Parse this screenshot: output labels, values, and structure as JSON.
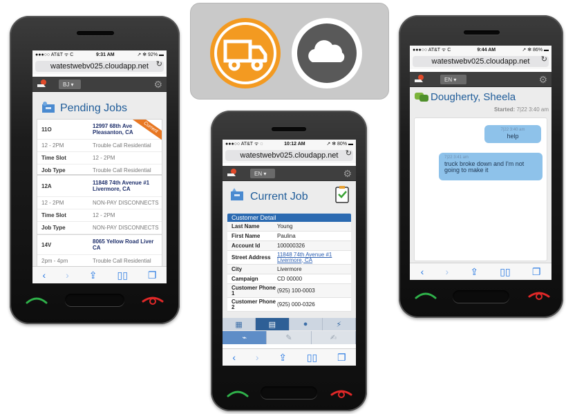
{
  "colors": {
    "accent": "#2b6ab1",
    "truck_orange": "#f39a21",
    "header_dark": "#3f3f3f",
    "bubble": "#8ec2ea",
    "current_ribbon": "#e87722"
  },
  "logo_banner": {
    "icons": [
      "truck-icon",
      "cloud-icon"
    ]
  },
  "phone_left": {
    "status": {
      "carrier": "●●●○○ AT&T ᯤ C",
      "time": "9:31 AM",
      "battery": "↗ ✻ 92% ▬"
    },
    "url": "watestwebv025.cloudapp.net",
    "lang": "BJ ▾",
    "title": "Pending Jobs",
    "jobs": [
      {
        "rows": [
          {
            "k": "11O",
            "v": "12997 68th Ave\nPleasanton, CA",
            "addr": true
          },
          {
            "k": "12 - 2PM",
            "v": "Trouble Call Residential",
            "light": true
          },
          {
            "k": "Time Slot",
            "v": "12 - 2PM",
            "vlight": true
          },
          {
            "k": "Job Type",
            "v": "Trouble Call Residential",
            "vlight": true
          }
        ],
        "ribbon": "Current"
      },
      {
        "rows": [
          {
            "k": "12A",
            "v": "11848 74th Avenue #1 Livermore, CA",
            "addr": true
          },
          {
            "k": "12 - 2PM",
            "v": "NON-PAY DISCONNECTS",
            "light": true
          },
          {
            "k": "Time Slot",
            "v": "12 - 2PM",
            "vlight": true
          },
          {
            "k": "Job Type",
            "v": "NON-PAY DISCONNECTS",
            "vlight": true
          }
        ]
      },
      {
        "rows": [
          {
            "k": "14V",
            "v": "8065 Yellow Road Liver CA",
            "addr": true
          },
          {
            "k": "2pm - 4pm",
            "v": "Trouble Call Residential",
            "light": true
          }
        ]
      }
    ]
  },
  "phone_center": {
    "status": {
      "carrier": "●●●○○ AT&T ᯤ ◌",
      "time": "10:12 AM",
      "battery": "↗ ✻ 80% ▬"
    },
    "url": "watestwebv025.cloudapp.net",
    "lang": "EN ▾",
    "title": "Current Job",
    "detail_header": "Customer Detail",
    "rows": [
      {
        "k": "Last Name",
        "v": "Young"
      },
      {
        "k": "First Name",
        "v": "Paulina"
      },
      {
        "k": "Account Id",
        "v": "100000326"
      },
      {
        "k": "Street Address",
        "v": "11848 74th Avenue #1 Livermore, CA",
        "link": true
      },
      {
        "k": "City",
        "v": "Livermore"
      },
      {
        "k": "Campaign",
        "v": "CD 00000"
      },
      {
        "k": "Customer Phone 1",
        "v": "(925) 100-0003"
      },
      {
        "k": "Customer Phone 2",
        "v": "(925) 000-0326"
      }
    ],
    "tabs": [
      "job-icon",
      "detail-icon",
      "person-icon",
      "plug-icon"
    ],
    "subtabs": [
      "signal-icon",
      "wrench-icon",
      "signature-icon"
    ]
  },
  "phone_right": {
    "status": {
      "carrier": "●●●○○ AT&T ᯤ C",
      "time": "9:44 AM",
      "battery": "↗ ✻ 86% ▬"
    },
    "url": "watestwebv025.cloudapp.net",
    "lang": "EN ▾",
    "contact": "Dougherty, Sheela",
    "started_label": "Started:",
    "started_value": "7|22 3:40 am",
    "messages": [
      {
        "time": "7|22 3:40 am",
        "text": "help"
      },
      {
        "time": "7|22 3:41 am",
        "text": "truck broke down and I'm not going to make it"
      }
    ]
  },
  "toolbar_icons": [
    "back-icon",
    "forward-icon",
    "share-icon",
    "bookmarks-icon",
    "tabs-icon"
  ]
}
